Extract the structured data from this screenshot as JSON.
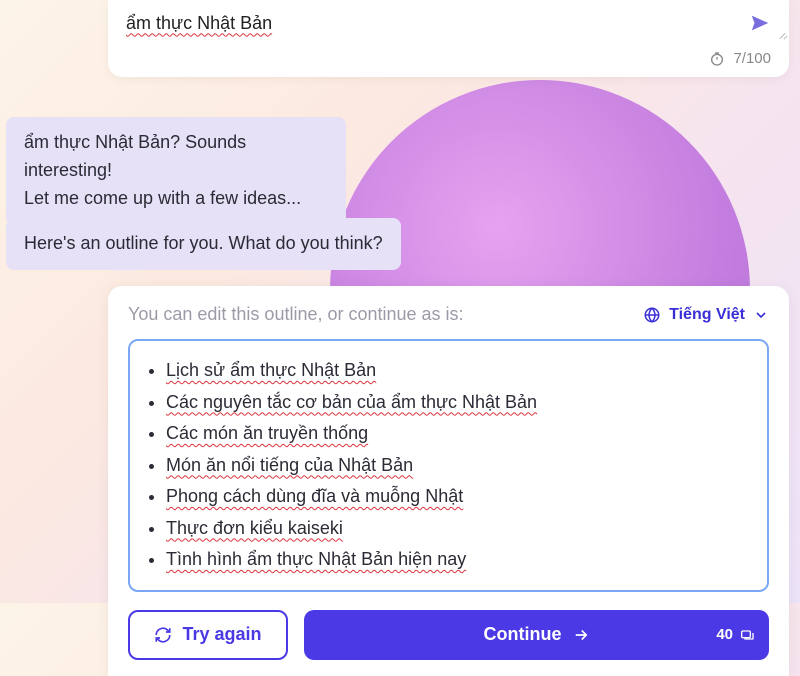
{
  "input": {
    "text": "ẩm thực Nhật Bản",
    "counter": "7/100"
  },
  "messages": {
    "bubble1_line1": "ẩm thực Nhật Bản? Sounds interesting!",
    "bubble1_line2": "Let me come up with a few ideas...",
    "bubble2": "Here's an outline for you. What do you think?"
  },
  "outline": {
    "hint": "You can edit this outline, or continue as is:",
    "language": "Tiếng Việt",
    "items": [
      "Lịch sử ẩm thực Nhật Bản",
      "Các nguyên tắc cơ bản của ẩm thực Nhật Bản",
      "Các món ăn truyền thống",
      "Món ăn nổi tiếng của Nhật Bản",
      "Phong cách dùng đĩa và muỗng Nhật",
      "Thực đơn kiểu kaiseki",
      "Tình hình ẩm thực Nhật Bản hiện nay"
    ]
  },
  "buttons": {
    "try_again": "Try again",
    "continue": "Continue",
    "badge": "40"
  }
}
